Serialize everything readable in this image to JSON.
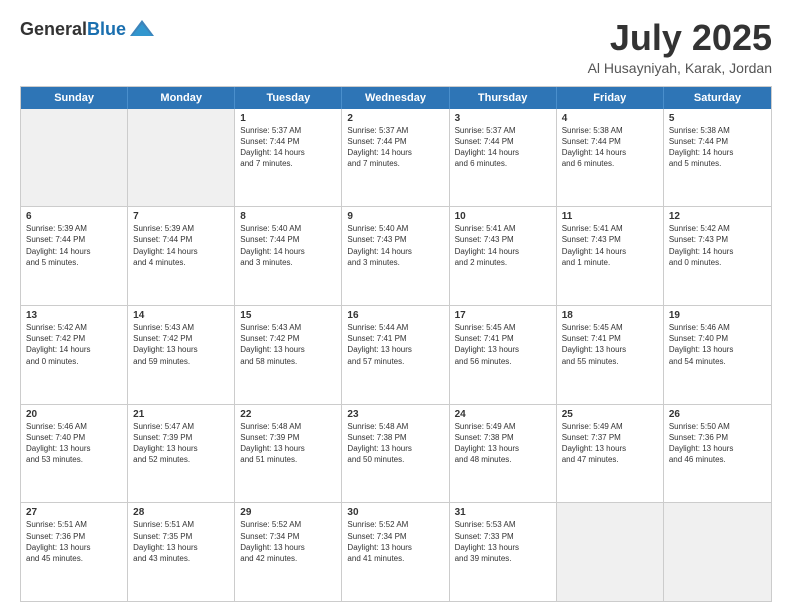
{
  "header": {
    "logo_general": "General",
    "logo_blue": "Blue",
    "month_title": "July 2025",
    "location": "Al Husayniyah, Karak, Jordan"
  },
  "weekdays": [
    "Sunday",
    "Monday",
    "Tuesday",
    "Wednesday",
    "Thursday",
    "Friday",
    "Saturday"
  ],
  "rows": [
    [
      {
        "day": "",
        "text": "",
        "empty": true
      },
      {
        "day": "",
        "text": "",
        "empty": true
      },
      {
        "day": "1",
        "text": "Sunrise: 5:37 AM\nSunset: 7:44 PM\nDaylight: 14 hours\nand 7 minutes."
      },
      {
        "day": "2",
        "text": "Sunrise: 5:37 AM\nSunset: 7:44 PM\nDaylight: 14 hours\nand 7 minutes."
      },
      {
        "day": "3",
        "text": "Sunrise: 5:37 AM\nSunset: 7:44 PM\nDaylight: 14 hours\nand 6 minutes."
      },
      {
        "day": "4",
        "text": "Sunrise: 5:38 AM\nSunset: 7:44 PM\nDaylight: 14 hours\nand 6 minutes."
      },
      {
        "day": "5",
        "text": "Sunrise: 5:38 AM\nSunset: 7:44 PM\nDaylight: 14 hours\nand 5 minutes."
      }
    ],
    [
      {
        "day": "6",
        "text": "Sunrise: 5:39 AM\nSunset: 7:44 PM\nDaylight: 14 hours\nand 5 minutes."
      },
      {
        "day": "7",
        "text": "Sunrise: 5:39 AM\nSunset: 7:44 PM\nDaylight: 14 hours\nand 4 minutes."
      },
      {
        "day": "8",
        "text": "Sunrise: 5:40 AM\nSunset: 7:44 PM\nDaylight: 14 hours\nand 3 minutes."
      },
      {
        "day": "9",
        "text": "Sunrise: 5:40 AM\nSunset: 7:43 PM\nDaylight: 14 hours\nand 3 minutes."
      },
      {
        "day": "10",
        "text": "Sunrise: 5:41 AM\nSunset: 7:43 PM\nDaylight: 14 hours\nand 2 minutes."
      },
      {
        "day": "11",
        "text": "Sunrise: 5:41 AM\nSunset: 7:43 PM\nDaylight: 14 hours\nand 1 minute."
      },
      {
        "day": "12",
        "text": "Sunrise: 5:42 AM\nSunset: 7:43 PM\nDaylight: 14 hours\nand 0 minutes."
      }
    ],
    [
      {
        "day": "13",
        "text": "Sunrise: 5:42 AM\nSunset: 7:42 PM\nDaylight: 14 hours\nand 0 minutes."
      },
      {
        "day": "14",
        "text": "Sunrise: 5:43 AM\nSunset: 7:42 PM\nDaylight: 13 hours\nand 59 minutes."
      },
      {
        "day": "15",
        "text": "Sunrise: 5:43 AM\nSunset: 7:42 PM\nDaylight: 13 hours\nand 58 minutes."
      },
      {
        "day": "16",
        "text": "Sunrise: 5:44 AM\nSunset: 7:41 PM\nDaylight: 13 hours\nand 57 minutes."
      },
      {
        "day": "17",
        "text": "Sunrise: 5:45 AM\nSunset: 7:41 PM\nDaylight: 13 hours\nand 56 minutes."
      },
      {
        "day": "18",
        "text": "Sunrise: 5:45 AM\nSunset: 7:41 PM\nDaylight: 13 hours\nand 55 minutes."
      },
      {
        "day": "19",
        "text": "Sunrise: 5:46 AM\nSunset: 7:40 PM\nDaylight: 13 hours\nand 54 minutes."
      }
    ],
    [
      {
        "day": "20",
        "text": "Sunrise: 5:46 AM\nSunset: 7:40 PM\nDaylight: 13 hours\nand 53 minutes."
      },
      {
        "day": "21",
        "text": "Sunrise: 5:47 AM\nSunset: 7:39 PM\nDaylight: 13 hours\nand 52 minutes."
      },
      {
        "day": "22",
        "text": "Sunrise: 5:48 AM\nSunset: 7:39 PM\nDaylight: 13 hours\nand 51 minutes."
      },
      {
        "day": "23",
        "text": "Sunrise: 5:48 AM\nSunset: 7:38 PM\nDaylight: 13 hours\nand 50 minutes."
      },
      {
        "day": "24",
        "text": "Sunrise: 5:49 AM\nSunset: 7:38 PM\nDaylight: 13 hours\nand 48 minutes."
      },
      {
        "day": "25",
        "text": "Sunrise: 5:49 AM\nSunset: 7:37 PM\nDaylight: 13 hours\nand 47 minutes."
      },
      {
        "day": "26",
        "text": "Sunrise: 5:50 AM\nSunset: 7:36 PM\nDaylight: 13 hours\nand 46 minutes."
      }
    ],
    [
      {
        "day": "27",
        "text": "Sunrise: 5:51 AM\nSunset: 7:36 PM\nDaylight: 13 hours\nand 45 minutes."
      },
      {
        "day": "28",
        "text": "Sunrise: 5:51 AM\nSunset: 7:35 PM\nDaylight: 13 hours\nand 43 minutes."
      },
      {
        "day": "29",
        "text": "Sunrise: 5:52 AM\nSunset: 7:34 PM\nDaylight: 13 hours\nand 42 minutes."
      },
      {
        "day": "30",
        "text": "Sunrise: 5:52 AM\nSunset: 7:34 PM\nDaylight: 13 hours\nand 41 minutes."
      },
      {
        "day": "31",
        "text": "Sunrise: 5:53 AM\nSunset: 7:33 PM\nDaylight: 13 hours\nand 39 minutes."
      },
      {
        "day": "",
        "text": "",
        "empty": true
      },
      {
        "day": "",
        "text": "",
        "empty": true
      }
    ]
  ]
}
